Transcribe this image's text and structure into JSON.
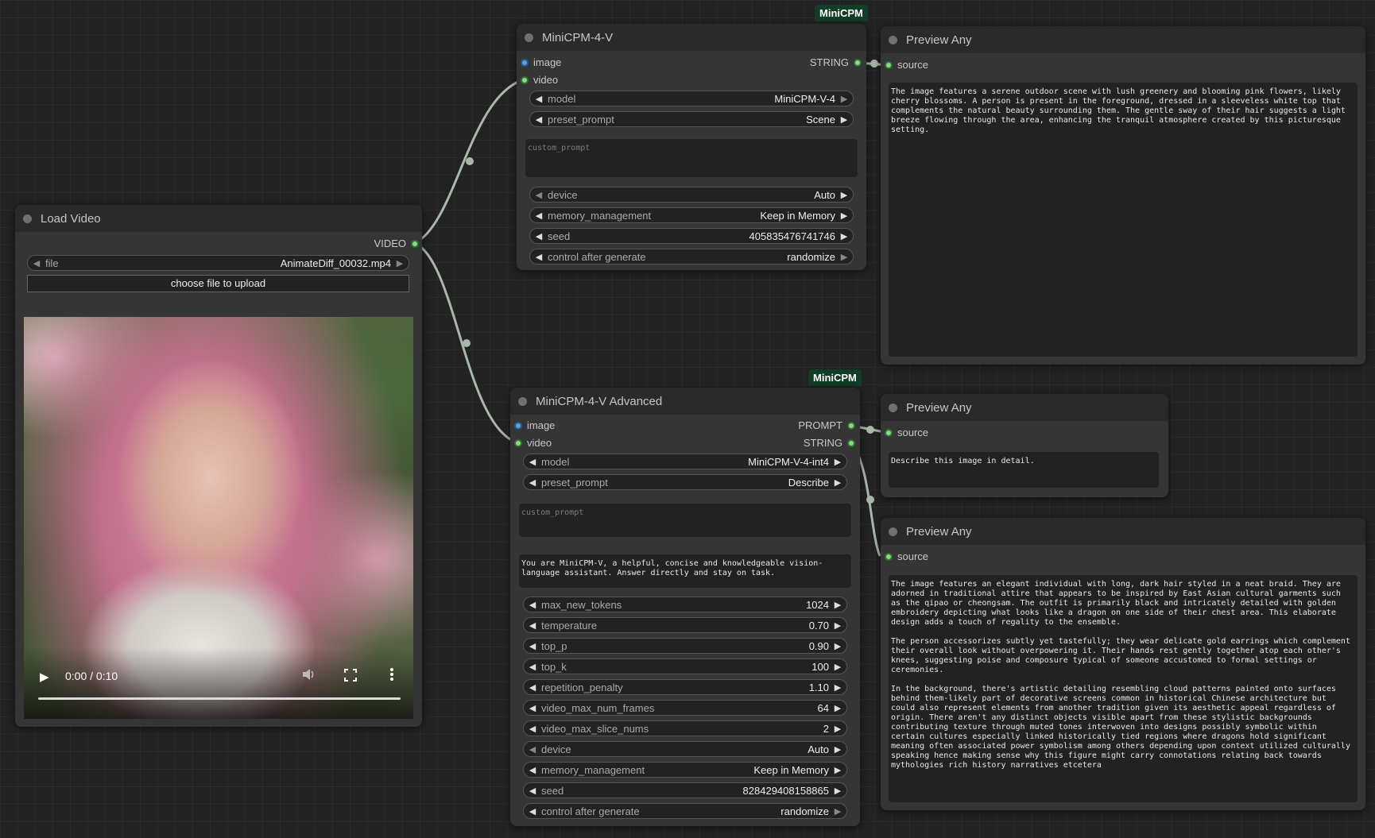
{
  "load_video": {
    "title": "Load Video",
    "output_label": "VIDEO",
    "file_label": "file",
    "file_value": "AnimateDiff_00032.mp4",
    "upload_label": "choose file to upload",
    "player": {
      "time": "0:00 / 0:10"
    }
  },
  "minicpm": {
    "badge": "MiniCPM",
    "title": "MiniCPM-4-V",
    "inputs": [
      "image",
      "video"
    ],
    "output_label": "STRING",
    "widgets": [
      {
        "label": "model",
        "value": "MiniCPM-V-4"
      },
      {
        "label": "preset_prompt",
        "value": "Scene"
      }
    ],
    "custom_prompt_placeholder": "custom_prompt",
    "widgets2": [
      {
        "label": "device",
        "value": "Auto"
      },
      {
        "label": "memory_management",
        "value": "Keep in Memory"
      },
      {
        "label": "seed",
        "value": "405835476741746"
      },
      {
        "label": "control after generate",
        "value": "randomize"
      }
    ]
  },
  "minicpm_adv": {
    "badge": "MiniCPM",
    "title": "MiniCPM-4-V Advanced",
    "inputs": [
      "image",
      "video"
    ],
    "outputs": [
      "PROMPT",
      "STRING"
    ],
    "widgets": [
      {
        "label": "model",
        "value": "MiniCPM-V-4-int4"
      },
      {
        "label": "preset_prompt",
        "value": "Describe"
      }
    ],
    "custom_prompt_placeholder": "custom_prompt",
    "system_prompt": "You are MiniCPM-V, a helpful, concise and knowledgeable vision-\nlanguage assistant. Answer directly and stay on task.",
    "widgets2": [
      {
        "label": "max_new_tokens",
        "value": "1024"
      },
      {
        "label": "temperature",
        "value": "0.70"
      },
      {
        "label": "top_p",
        "value": "0.90"
      },
      {
        "label": "top_k",
        "value": "100"
      },
      {
        "label": "repetition_penalty",
        "value": "1.10"
      },
      {
        "label": "video_max_num_frames",
        "value": "64"
      },
      {
        "label": "video_max_slice_nums",
        "value": "2"
      },
      {
        "label": "device",
        "value": "Auto"
      },
      {
        "label": "memory_management",
        "value": "Keep in Memory"
      },
      {
        "label": "seed",
        "value": "828429408158865"
      },
      {
        "label": "control after generate",
        "value": "randomize"
      }
    ]
  },
  "preview1": {
    "title": "Preview Any",
    "input_label": "source",
    "text": "The image features a serene outdoor scene with lush greenery and blooming pink flowers, likely\ncherry blossoms. A person is present in the foreground, dressed in a sleeveless white top that\ncomplements the natural beauty surrounding them. The gentle sway of their hair suggests a light\nbreeze flowing through the area, enhancing the tranquil atmosphere created by this picturesque\nsetting."
  },
  "preview2": {
    "title": "Preview Any",
    "input_label": "source",
    "text": "Describe this image in detail."
  },
  "preview3": {
    "title": "Preview Any",
    "input_label": "source",
    "text": "The image features an elegant individual with long, dark hair styled in a neat braid. They are\nadorned in traditional attire that appears to be inspired by East Asian cultural garments such\nas the qipao or cheongsam. The outfit is primarily black and intricately detailed with golden\nembroidery depicting what looks like a dragon on one side of their chest area. This elaborate\ndesign adds a touch of regality to the ensemble.\n\nThe person accessorizes subtly yet tastefully; they wear delicate gold earrings which complement\ntheir overall look without overpowering it. Their hands rest gently together atop each other's\nknees, suggesting poise and composure typical of someone accustomed to formal settings or\nceremonies.\n\nIn the background, there's artistic detailing resembling cloud patterns painted onto surfaces\nbehind them-likely part of decorative screens common in historical Chinese architecture but\ncould also represent elements from another tradition given its aesthetic appeal regardless of\norigin. There aren't any distinct objects visible apart from these stylistic backgrounds\ncontributing texture through muted tones interwoven into designs possibly symbolic within\ncertain cultures especially linked historically tied regions where dragons hold significant\nmeaning often associated power symbolism among others depending upon context utilized culturally\nspeaking hence making sense why this figure might carry connotations relating back towards\nmythologies rich history narratives etcetera"
  },
  "colors": {
    "link_video": "#a8b8a8",
    "link_string": "#a8b8a8",
    "badge_bg": "#123d26",
    "slot_green": "#7fe07f",
    "slot_blue": "#5aa0e0"
  }
}
